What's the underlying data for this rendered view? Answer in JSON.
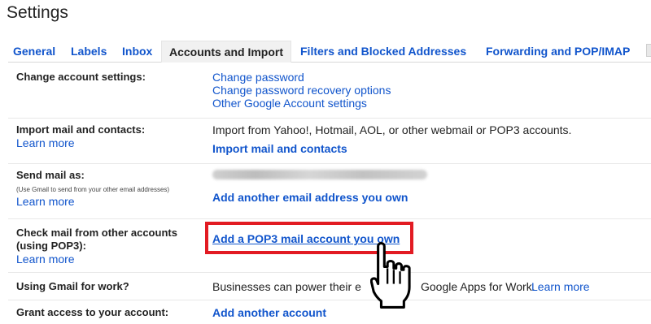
{
  "header": {
    "title": "Settings"
  },
  "tabs": [
    {
      "label": "General"
    },
    {
      "label": "Labels"
    },
    {
      "label": "Inbox"
    },
    {
      "label": "Accounts and Import"
    },
    {
      "label": "Filters and Blocked Addresses"
    },
    {
      "label": "Forwarding and POP/IMAP"
    }
  ],
  "rows": {
    "change_account": {
      "label": "Change account settings:",
      "links": [
        "Change password",
        "Change password recovery options",
        "Other Google Account settings"
      ]
    },
    "import_mail": {
      "label": "Import mail and contacts:",
      "learn_more": "Learn more",
      "description": "Import from Yahoo!, Hotmail, AOL, or other webmail or POP3 accounts.",
      "action": "Import mail and contacts"
    },
    "send_mail": {
      "label": "Send mail as:",
      "sublabel": "(Use Gmail to send from your other email addresses)",
      "learn_more": "Learn more",
      "action": "Add another email address you own"
    },
    "check_mail": {
      "label_line1": "Check mail from other accounts",
      "label_line2": "(using POP3):",
      "learn_more": "Learn more",
      "action": "Add a POP3 mail account you own"
    },
    "gmail_work": {
      "label": "Using Gmail for work?",
      "text_start": "Businesses can power their e",
      "text_end": "Google Apps for Work.",
      "learn_more": "Learn more"
    },
    "grant_access": {
      "label": "Grant access to your account:",
      "action": "Add another account"
    }
  },
  "colors": {
    "link": "#1155cc",
    "highlight": "#e21b23",
    "text": "#222222"
  },
  "icons": {
    "cursor": "hand-pointer-icon"
  }
}
